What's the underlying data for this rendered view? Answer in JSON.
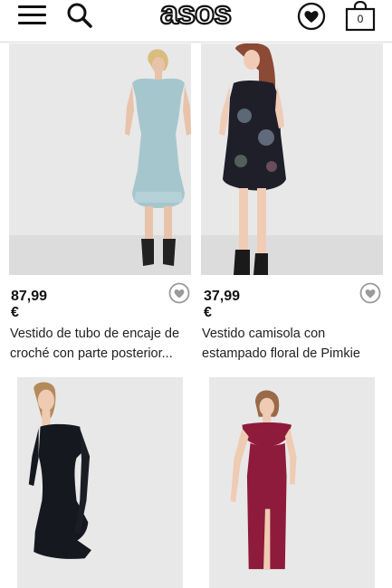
{
  "header": {
    "brand": "asos",
    "bag_count": "0",
    "icons": [
      "menu-icon",
      "search-icon",
      "heart-icon",
      "shopping-bag-icon"
    ]
  },
  "products": [
    {
      "price": "87,99 €",
      "title_line1": "Vestido de tubo de encaje de",
      "title_line2": "croché con parte posterior...",
      "dress_color": "#a6c6ce"
    },
    {
      "price": "37,99 €",
      "title_line1": "Vestido camisola con",
      "title_line2": "estampado floral de Pimkie",
      "dress_color": "#1f1f2a"
    },
    {
      "price": "",
      "title_line1": "",
      "title_line2": "",
      "dress_color": "#161820"
    },
    {
      "price": "",
      "title_line1": "",
      "title_line2": "",
      "dress_color": "#8e1a3c"
    }
  ],
  "colors": {
    "photo_bg": "#e8e8e8",
    "floor": "#dcdcdc",
    "divider": "#d8d8d8",
    "icon_dark": "#111111",
    "heart_grey": "#9a9a9a"
  }
}
